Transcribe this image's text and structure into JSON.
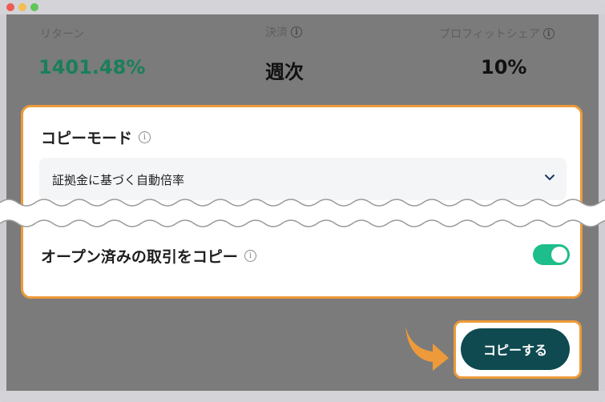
{
  "colors": {
    "accent_outline": "#ee9a3a",
    "return_green": "#1a7f5a",
    "toggle_on": "#1dbd8c",
    "button_bg": "#0e4a50"
  },
  "stats": {
    "return": {
      "label": "リターン",
      "value": "1401.48%"
    },
    "settlement": {
      "label": "決済",
      "value": "週次",
      "info_icon": "i"
    },
    "profit_share": {
      "label": "プロフィットシェア",
      "value": "10%",
      "info_icon": "i"
    }
  },
  "copy_mode": {
    "title": "コピーモード",
    "info_icon": "i",
    "selected": "証拠金に基づく自動倍率"
  },
  "open_trades": {
    "label": "オープン済みの取引をコピー",
    "info_icon": "i",
    "enabled": true
  },
  "copy_button": {
    "label": "コピーする"
  }
}
